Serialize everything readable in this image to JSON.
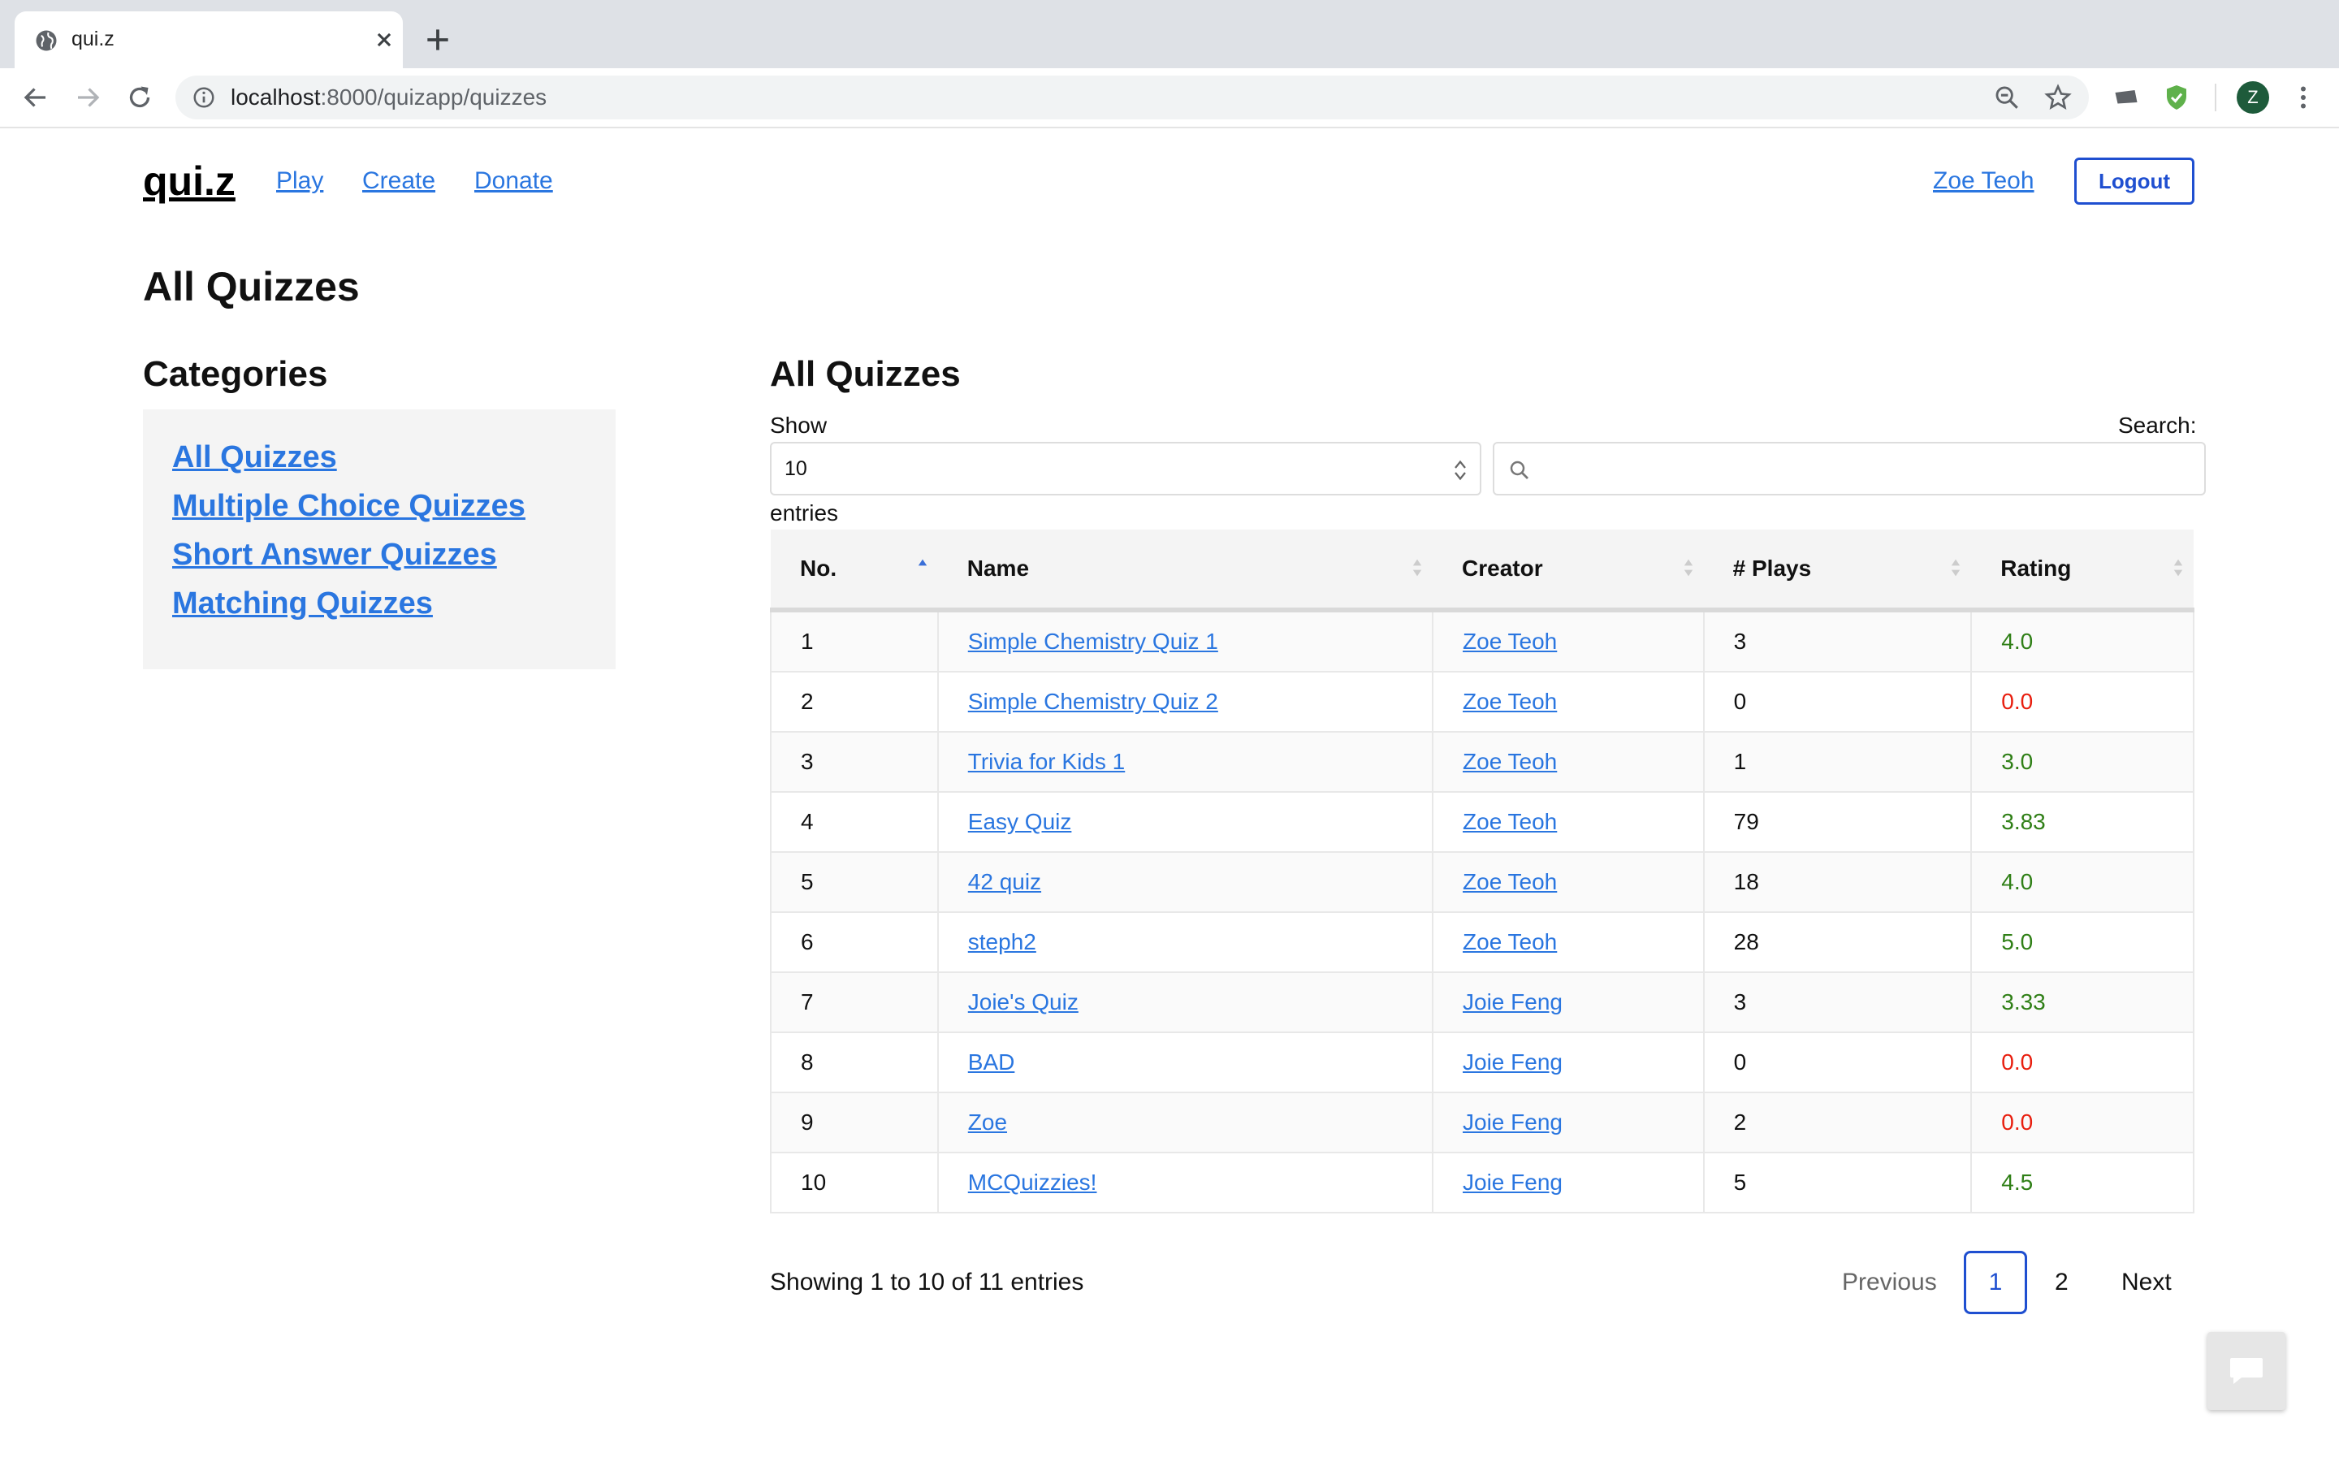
{
  "browser": {
    "tab_title": "qui.z",
    "url_host": "localhost",
    "url_rest": ":8000/quizapp/quizzes",
    "profile_initial": "Z"
  },
  "header": {
    "brand": "qui.z",
    "nav": [
      "Play",
      "Create",
      "Donate"
    ],
    "user": "Zoe Teoh",
    "logout": "Logout"
  },
  "page_title": "All Quizzes",
  "categories": {
    "heading": "Categories",
    "items": [
      "All Quizzes",
      "Multiple Choice Quizzes",
      "Short Answer Quizzes",
      "Matching Quizzes"
    ]
  },
  "main": {
    "heading": "All Quizzes",
    "show_label": "Show",
    "page_length": "10",
    "entries_label": "entries",
    "search_label": "Search:",
    "search_value": ""
  },
  "table": {
    "columns": [
      "No.",
      "Name",
      "Creator",
      "# Plays",
      "Rating"
    ],
    "rows": [
      {
        "no": "1",
        "name": "Simple Chemistry Quiz 1",
        "creator": "Zoe Teoh",
        "plays": "3",
        "rating": "4.0"
      },
      {
        "no": "2",
        "name": "Simple Chemistry Quiz 2",
        "creator": "Zoe Teoh",
        "plays": "0",
        "rating": "0.0"
      },
      {
        "no": "3",
        "name": "Trivia for Kids 1",
        "creator": "Zoe Teoh",
        "plays": "1",
        "rating": "3.0"
      },
      {
        "no": "4",
        "name": "Easy Quiz",
        "creator": "Zoe Teoh",
        "plays": "79",
        "rating": "3.83"
      },
      {
        "no": "5",
        "name": "42 quiz",
        "creator": "Zoe Teoh",
        "plays": "18",
        "rating": "4.0"
      },
      {
        "no": "6",
        "name": "steph2",
        "creator": "Zoe Teoh",
        "plays": "28",
        "rating": "5.0"
      },
      {
        "no": "7",
        "name": "Joie's Quiz",
        "creator": "Joie Feng",
        "plays": "3",
        "rating": "3.33"
      },
      {
        "no": "8",
        "name": "BAD",
        "creator": "Joie Feng",
        "plays": "0",
        "rating": "0.0"
      },
      {
        "no": "9",
        "name": "Zoe",
        "creator": "Joie Feng",
        "plays": "2",
        "rating": "0.0"
      },
      {
        "no": "10",
        "name": "MCQuizzies!",
        "creator": "Joie Feng",
        "plays": "5",
        "rating": "4.5"
      }
    ]
  },
  "footer": {
    "info": "Showing 1 to 10 of 11 entries",
    "previous": "Previous",
    "pages": [
      "1",
      "2"
    ],
    "next": "Next"
  },
  "colors": {
    "link": "#2a76e0",
    "primary": "#1f4fd0",
    "rating_good": "#2f7f16",
    "rating_bad": "#e81e0e"
  }
}
